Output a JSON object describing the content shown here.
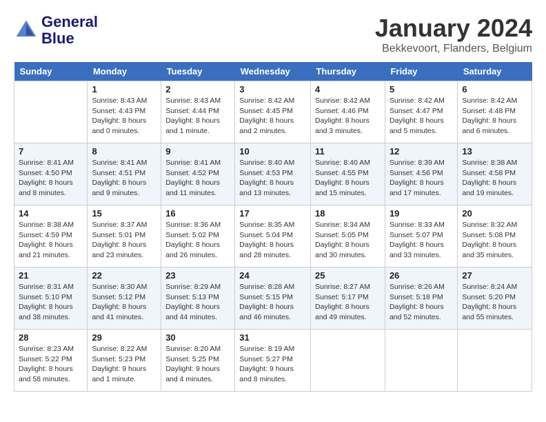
{
  "header": {
    "logo_line1": "General",
    "logo_line2": "Blue",
    "month_title": "January 2024",
    "location": "Bekkevoort, Flanders, Belgium"
  },
  "weekdays": [
    "Sunday",
    "Monday",
    "Tuesday",
    "Wednesday",
    "Thursday",
    "Friday",
    "Saturday"
  ],
  "weeks": [
    [
      {
        "day": null
      },
      {
        "day": 1,
        "sunrise": "8:43 AM",
        "sunset": "4:43 PM",
        "daylight": "8 hours and 0 minutes."
      },
      {
        "day": 2,
        "sunrise": "8:43 AM",
        "sunset": "4:44 PM",
        "daylight": "8 hours and 1 minute."
      },
      {
        "day": 3,
        "sunrise": "8:42 AM",
        "sunset": "4:45 PM",
        "daylight": "8 hours and 2 minutes."
      },
      {
        "day": 4,
        "sunrise": "8:42 AM",
        "sunset": "4:46 PM",
        "daylight": "8 hours and 3 minutes."
      },
      {
        "day": 5,
        "sunrise": "8:42 AM",
        "sunset": "4:47 PM",
        "daylight": "8 hours and 5 minutes."
      },
      {
        "day": 6,
        "sunrise": "8:42 AM",
        "sunset": "4:48 PM",
        "daylight": "8 hours and 6 minutes."
      }
    ],
    [
      {
        "day": 7,
        "sunrise": "8:41 AM",
        "sunset": "4:50 PM",
        "daylight": "8 hours and 8 minutes."
      },
      {
        "day": 8,
        "sunrise": "8:41 AM",
        "sunset": "4:51 PM",
        "daylight": "8 hours and 9 minutes."
      },
      {
        "day": 9,
        "sunrise": "8:41 AM",
        "sunset": "4:52 PM",
        "daylight": "8 hours and 11 minutes."
      },
      {
        "day": 10,
        "sunrise": "8:40 AM",
        "sunset": "4:53 PM",
        "daylight": "8 hours and 13 minutes."
      },
      {
        "day": 11,
        "sunrise": "8:40 AM",
        "sunset": "4:55 PM",
        "daylight": "8 hours and 15 minutes."
      },
      {
        "day": 12,
        "sunrise": "8:39 AM",
        "sunset": "4:56 PM",
        "daylight": "8 hours and 17 minutes."
      },
      {
        "day": 13,
        "sunrise": "8:38 AM",
        "sunset": "4:58 PM",
        "daylight": "8 hours and 19 minutes."
      }
    ],
    [
      {
        "day": 14,
        "sunrise": "8:38 AM",
        "sunset": "4:59 PM",
        "daylight": "8 hours and 21 minutes."
      },
      {
        "day": 15,
        "sunrise": "8:37 AM",
        "sunset": "5:01 PM",
        "daylight": "8 hours and 23 minutes."
      },
      {
        "day": 16,
        "sunrise": "8:36 AM",
        "sunset": "5:02 PM",
        "daylight": "8 hours and 26 minutes."
      },
      {
        "day": 17,
        "sunrise": "8:35 AM",
        "sunset": "5:04 PM",
        "daylight": "8 hours and 28 minutes."
      },
      {
        "day": 18,
        "sunrise": "8:34 AM",
        "sunset": "5:05 PM",
        "daylight": "8 hours and 30 minutes."
      },
      {
        "day": 19,
        "sunrise": "8:33 AM",
        "sunset": "5:07 PM",
        "daylight": "8 hours and 33 minutes."
      },
      {
        "day": 20,
        "sunrise": "8:32 AM",
        "sunset": "5:08 PM",
        "daylight": "8 hours and 35 minutes."
      }
    ],
    [
      {
        "day": 21,
        "sunrise": "8:31 AM",
        "sunset": "5:10 PM",
        "daylight": "8 hours and 38 minutes."
      },
      {
        "day": 22,
        "sunrise": "8:30 AM",
        "sunset": "5:12 PM",
        "daylight": "8 hours and 41 minutes."
      },
      {
        "day": 23,
        "sunrise": "8:29 AM",
        "sunset": "5:13 PM",
        "daylight": "8 hours and 44 minutes."
      },
      {
        "day": 24,
        "sunrise": "8:28 AM",
        "sunset": "5:15 PM",
        "daylight": "8 hours and 46 minutes."
      },
      {
        "day": 25,
        "sunrise": "8:27 AM",
        "sunset": "5:17 PM",
        "daylight": "8 hours and 49 minutes."
      },
      {
        "day": 26,
        "sunrise": "8:26 AM",
        "sunset": "5:18 PM",
        "daylight": "8 hours and 52 minutes."
      },
      {
        "day": 27,
        "sunrise": "8:24 AM",
        "sunset": "5:20 PM",
        "daylight": "8 hours and 55 minutes."
      }
    ],
    [
      {
        "day": 28,
        "sunrise": "8:23 AM",
        "sunset": "5:22 PM",
        "daylight": "8 hours and 58 minutes."
      },
      {
        "day": 29,
        "sunrise": "8:22 AM",
        "sunset": "5:23 PM",
        "daylight": "9 hours and 1 minute."
      },
      {
        "day": 30,
        "sunrise": "8:20 AM",
        "sunset": "5:25 PM",
        "daylight": "9 hours and 4 minutes."
      },
      {
        "day": 31,
        "sunrise": "8:19 AM",
        "sunset": "5:27 PM",
        "daylight": "9 hours and 8 minutes."
      },
      {
        "day": null
      },
      {
        "day": null
      },
      {
        "day": null
      }
    ]
  ]
}
